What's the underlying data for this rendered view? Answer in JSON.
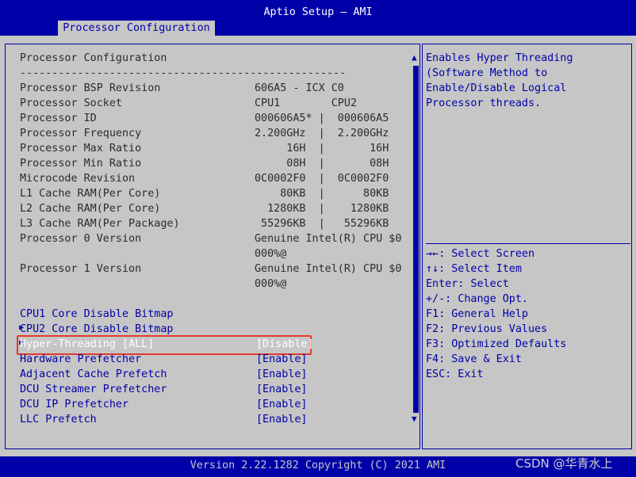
{
  "window": {
    "title": "Aptio Setup – AMI",
    "tab": "Processor Configuration"
  },
  "main": {
    "section_title": "Processor Configuration",
    "separator": "---------------------------------------------------",
    "info": [
      {
        "label": "Processor BSP Revision",
        "value": "606A5 - ICX C0"
      },
      {
        "label": "Processor Socket",
        "value": "CPU1        CPU2"
      },
      {
        "label": "Processor ID",
        "value": "000606A5* |  000606A5"
      },
      {
        "label": "Processor Frequency",
        "value": "2.200GHz  |  2.200GHz"
      },
      {
        "label": "Processor Max Ratio",
        "value": "     16H  |       16H"
      },
      {
        "label": "Processor Min Ratio",
        "value": "     08H  |       08H"
      },
      {
        "label": "Microcode Revision",
        "value": "0C0002F0  |  0C0002F0"
      },
      {
        "label": "L1 Cache RAM(Per Core)",
        "value": "    80KB  |      80KB"
      },
      {
        "label": "L2 Cache RAM(Per Core)",
        "value": "  1280KB  |    1280KB"
      },
      {
        "label": "L3 Cache RAM(Per Package)",
        "value": " 55296KB  |   55296KB"
      },
      {
        "label": "Processor 0 Version",
        "value": "Genuine Intel(R) CPU $0",
        "value2": "000%@"
      },
      {
        "label": "Processor 1 Version",
        "value": "Genuine Intel(R) CPU $0",
        "value2": "000%@"
      }
    ],
    "submenus": [
      "CPU1 Core Disable Bitmap",
      "CPU2 Core Disable Bitmap"
    ],
    "options": [
      {
        "label": "Hyper-Threading [ALL]",
        "value": "[Disable]"
      },
      {
        "label": "Hardware Prefetcher",
        "value": "[Enable]"
      },
      {
        "label": "Adjacent Cache Prefetch",
        "value": "[Enable]"
      },
      {
        "label": "DCU Streamer Prefetcher",
        "value": "[Enable]"
      },
      {
        "label": "DCU IP Prefetcher",
        "value": "[Enable]"
      },
      {
        "label": "LLC Prefetch",
        "value": "[Enable]"
      }
    ]
  },
  "help": {
    "lines": [
      "Enables Hyper Threading",
      "(Software Method to",
      "Enable/Disable Logical",
      "Processor threads."
    ],
    "keys": [
      "→←: Select Screen",
      "↑↓: Select Item",
      "Enter: Select",
      "+/-: Change Opt.",
      "F1: General Help",
      "F2: Previous Values",
      "F3: Optimized Defaults",
      "F4: Save & Exit",
      "ESC: Exit"
    ]
  },
  "footer": {
    "version": "Version 2.22.1282 Copyright (C) 2021 AMI",
    "watermark": "CSDN @华青水上"
  }
}
